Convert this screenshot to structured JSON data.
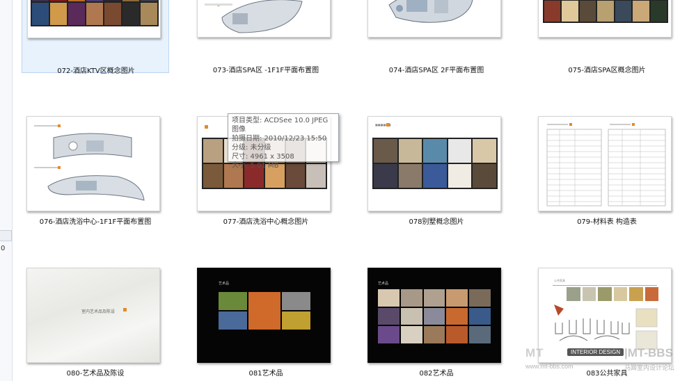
{
  "files": [
    {
      "name": "072-酒店KTV区概念图片",
      "selected": true
    },
    {
      "name": "073-酒店SPA区 -1F1F平面布置图"
    },
    {
      "name": "074-酒店SPA区 2F平面布置图"
    },
    {
      "name": "075-酒店SPA区概念图片"
    },
    {
      "name": "076-酒店洗浴中心-1F1F平面布置图"
    },
    {
      "name": "077-酒店洗浴中心概念图片"
    },
    {
      "name": "078别墅概念图片"
    },
    {
      "name": "079-材料表 构造表"
    },
    {
      "name": "080-艺术品及陈设"
    },
    {
      "name": "081艺术品"
    },
    {
      "name": "082艺术品"
    },
    {
      "name": "083公共家具"
    }
  ],
  "tooltip": {
    "type": "项目类型: ACDSee 10.0 JPEG 图像",
    "date": "拍摄日期: 2010/12/23 15:50",
    "rating": "分级: 未分级",
    "size": "尺寸: 4961 x 3508",
    "filesize": "大小: 5.01 MB"
  },
  "left_pane": {
    "digit": "0"
  },
  "thumb_text": {
    "art_title": "艺术品",
    "art_title2": "艺术品",
    "furniture_title": "公共家具",
    "deco_title": "室内艺术品及陈设"
  },
  "watermark": {
    "brand": "MT",
    "pill": "INTERIOR DESIGN",
    "right": "|MT-BBS",
    "small": "www.mt-bbs.com",
    "small_cn": "马蹄室内设计论坛"
  },
  "colors": {
    "selection": "#e8f2fc",
    "selection_border": "#b9d4f1",
    "accent_orange": "#e48a2a"
  }
}
